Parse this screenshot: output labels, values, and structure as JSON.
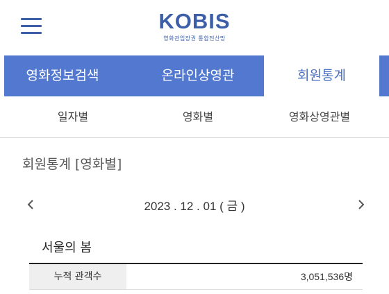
{
  "header": {
    "logo_title": "KOBIS",
    "logo_subtitle": "영화관입장권 통합전산망"
  },
  "main_nav": {
    "tabs": [
      {
        "label": "영화정보검색"
      },
      {
        "label": "온라인상영관"
      },
      {
        "label": "회원통계"
      }
    ],
    "active_index": 2
  },
  "sub_nav": {
    "items": [
      {
        "label": "일자별"
      },
      {
        "label": "영화별"
      },
      {
        "label": "영화상영관별"
      }
    ]
  },
  "page": {
    "title": "회원통계 [영화별]"
  },
  "date_nav": {
    "date": "2023 . 12 . 01 ( 금 )"
  },
  "movie": {
    "title": "서울의 봄",
    "stats": [
      {
        "label": "누적 관객수",
        "value": "3,051,536명"
      }
    ]
  },
  "colors": {
    "brand": "#3d5fa8",
    "nav_active_bg": "#5278cf",
    "nav_text_inactive": "#4a6fbf"
  },
  "icons": {
    "menu": "hamburger-menu-icon",
    "prev": "chevron-left-icon",
    "next": "chevron-right-icon"
  }
}
